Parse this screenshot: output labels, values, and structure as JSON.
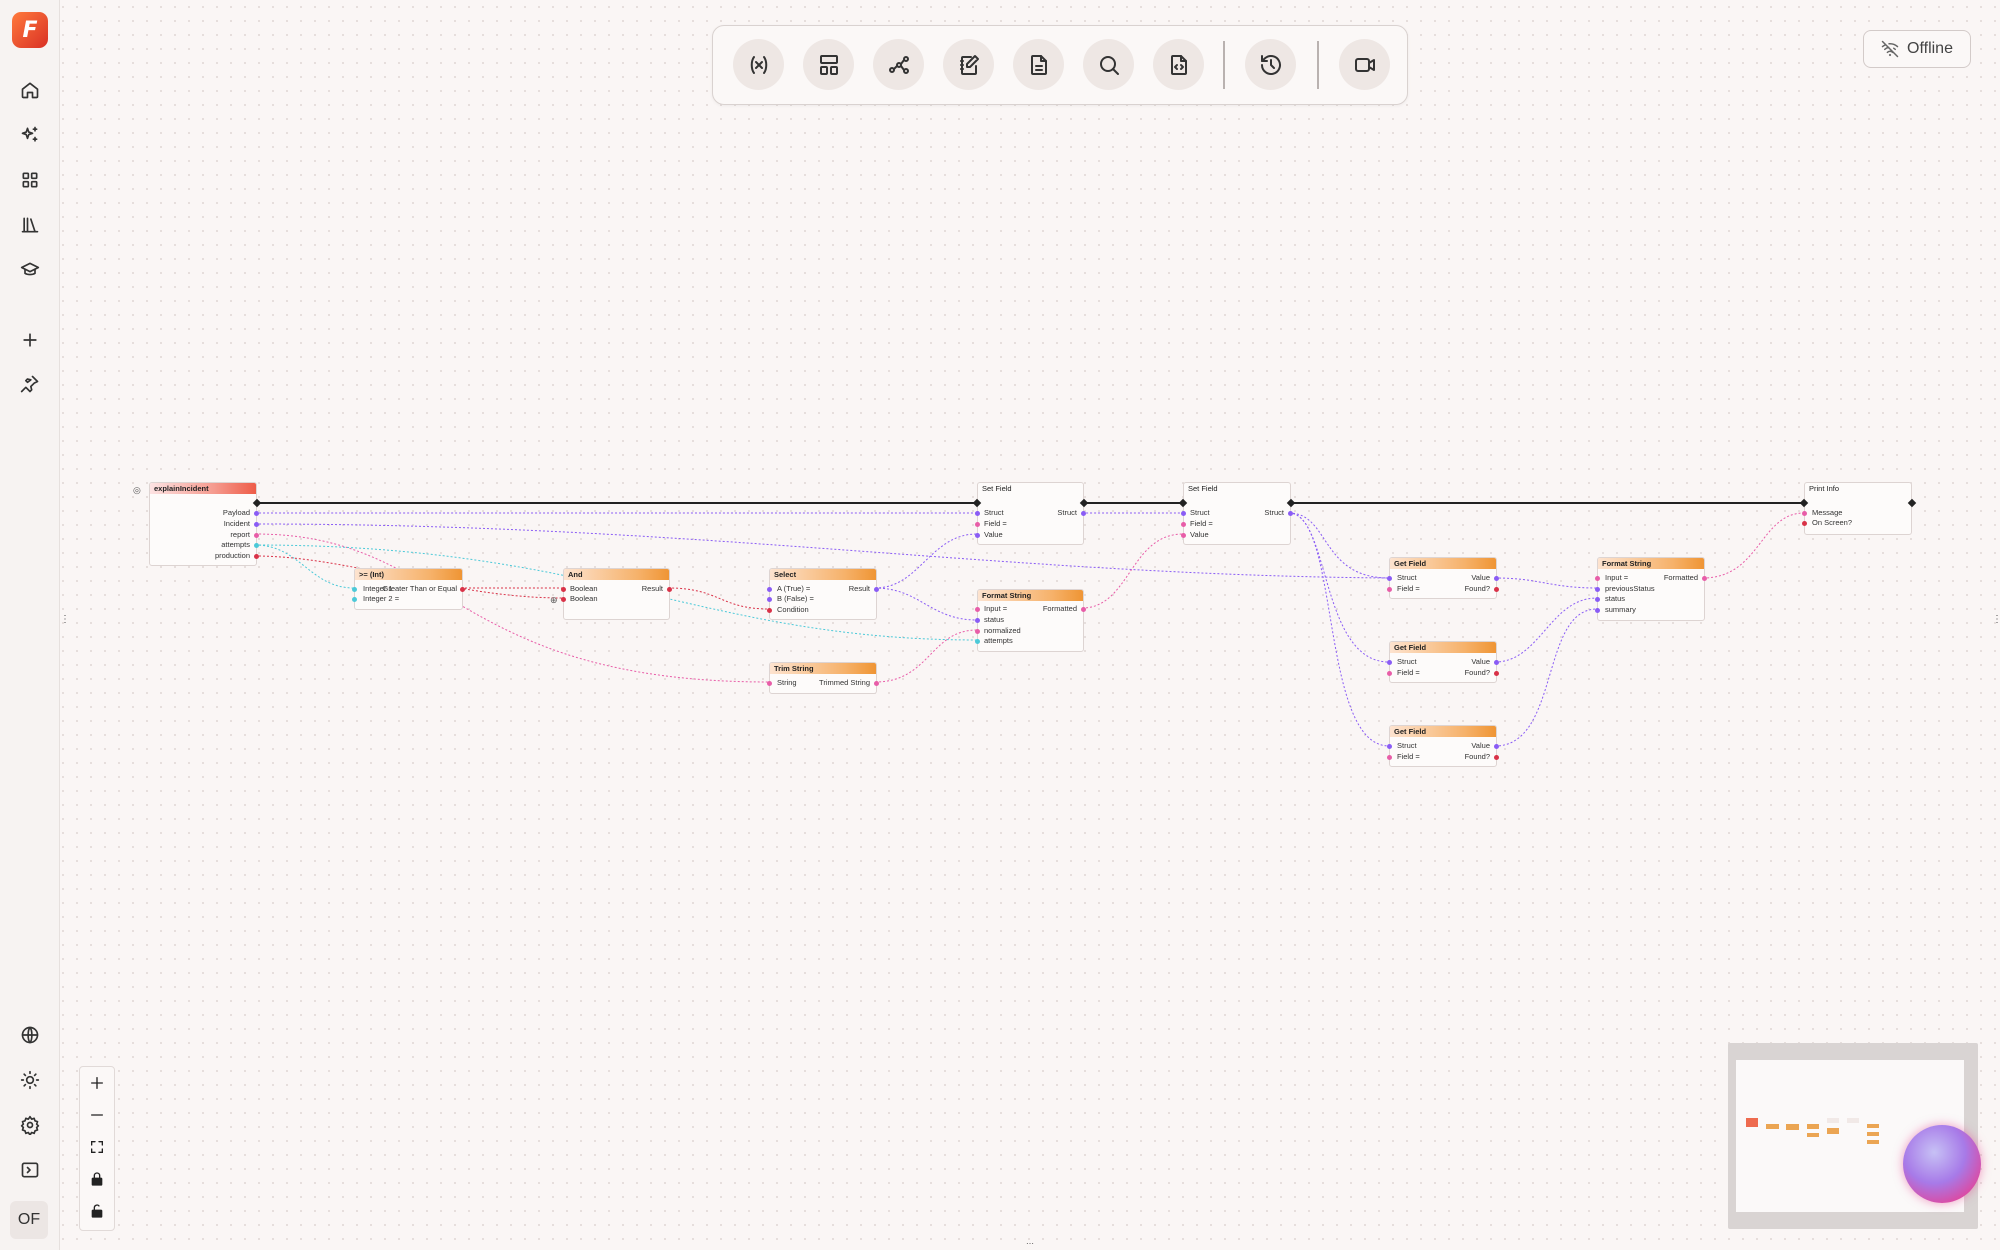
{
  "app": {
    "logo_letter": "F",
    "user_initials": "OF"
  },
  "sidebar": {
    "top_items": [
      {
        "name": "home-icon",
        "label": "Home"
      },
      {
        "name": "sparkles-icon",
        "label": "Explore"
      },
      {
        "name": "grid-icon",
        "label": "Apps"
      },
      {
        "name": "library-icon",
        "label": "Library"
      },
      {
        "name": "graduation-cap-icon",
        "label": "Learn"
      },
      {
        "name": "plus-icon",
        "label": "New"
      },
      {
        "name": "pin-icon",
        "label": "Pinned"
      }
    ],
    "bottom_items": [
      {
        "name": "globe-icon",
        "label": "Language"
      },
      {
        "name": "sun-icon",
        "label": "Theme"
      },
      {
        "name": "gear-icon",
        "label": "Settings"
      },
      {
        "name": "terminal-icon",
        "label": "Console"
      }
    ]
  },
  "toolbar": {
    "buttons": [
      "variables-icon",
      "layout-icon",
      "graph-icon",
      "notes-icon",
      "document-icon",
      "search-icon",
      "code-file-icon",
      "history-icon",
      "video-icon"
    ]
  },
  "status": {
    "label": "Offline"
  },
  "nodes": {
    "event": {
      "title": "explainIncident",
      "outputs": [
        "Payload",
        "Incident",
        "report",
        "attempts",
        "production"
      ]
    },
    "gte": {
      "title": ">= (Int)",
      "inputs": [
        "Integer 1",
        "Integer 2 ="
      ],
      "output": "Greater Than or Equal"
    },
    "and": {
      "title": "And",
      "inputs": [
        "Boolean",
        "Boolean"
      ],
      "output": "Result"
    },
    "select": {
      "title": "Select",
      "inputs": [
        "A (True) =",
        "B (False) =",
        "Condition"
      ],
      "output": "Result"
    },
    "trim": {
      "title": "Trim String",
      "input": "String",
      "output": "Trimmed String"
    },
    "setfield1": {
      "title": "Set Field",
      "inputs": [
        "Struct",
        "Field =",
        "Value"
      ],
      "output": "Struct"
    },
    "format1": {
      "title": "Format String",
      "inputs": [
        "Input =",
        "status",
        "normalized",
        "attempts"
      ],
      "output": "Formatted"
    },
    "setfield2": {
      "title": "Set Field",
      "inputs": [
        "Struct",
        "Field =",
        "Value"
      ],
      "output": "Struct"
    },
    "getfield1": {
      "title": "Get Field",
      "inputs": [
        "Struct",
        "Field ="
      ],
      "outputs": [
        "Value",
        "Found?"
      ]
    },
    "getfield2": {
      "title": "Get Field",
      "inputs": [
        "Struct",
        "Field ="
      ],
      "outputs": [
        "Value",
        "Found?"
      ]
    },
    "getfield3": {
      "title": "Get Field",
      "inputs": [
        "Struct",
        "Field ="
      ],
      "outputs": [
        "Value",
        "Found?"
      ]
    },
    "format2": {
      "title": "Format String",
      "inputs": [
        "Input =",
        "previousStatus",
        "status",
        "summary"
      ],
      "output": "Formatted"
    },
    "print": {
      "title": "Print Info",
      "inputs": [
        "Message",
        "On Screen?"
      ]
    }
  },
  "colors": {
    "struct_pin": "#8a5cf5",
    "string_pin": "#e85da8",
    "bool_pin": "#d93248",
    "int_pin": "#4cc9d8",
    "accent_orange": "#ef9534",
    "event_red": "#ee5c48"
  }
}
